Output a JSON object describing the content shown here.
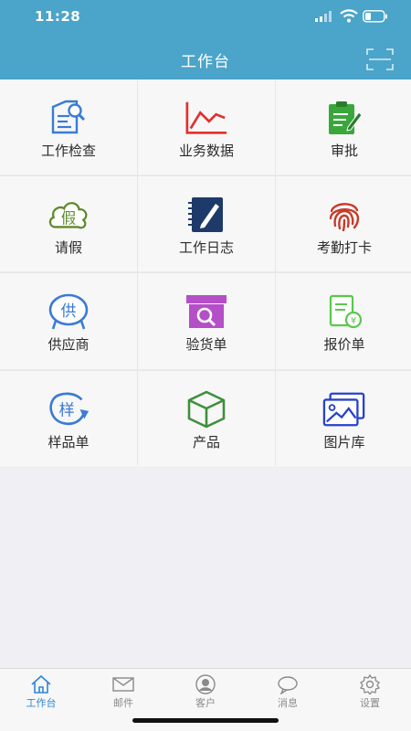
{
  "status_bar": {
    "time": "11:28"
  },
  "header": {
    "title": "工作台"
  },
  "grid": [
    {
      "label": "工作检查",
      "icon": "document-search-icon"
    },
    {
      "label": "业务数据",
      "icon": "line-chart-icon"
    },
    {
      "label": "审批",
      "icon": "clipboard-edit-icon"
    },
    {
      "label": "请假",
      "icon": "cloud-leave-icon",
      "glyph": "假"
    },
    {
      "label": "工作日志",
      "icon": "notebook-pen-icon"
    },
    {
      "label": "考勤打卡",
      "icon": "fingerprint-icon"
    },
    {
      "label": "供应商",
      "icon": "supplier-icon",
      "glyph": "供"
    },
    {
      "label": "验货单",
      "icon": "inspection-box-icon"
    },
    {
      "label": "报价单",
      "icon": "quote-document-icon",
      "glyph": "¥"
    },
    {
      "label": "样品单",
      "icon": "sample-refresh-icon",
      "glyph": "样"
    },
    {
      "label": "产品",
      "icon": "cube-icon"
    },
    {
      "label": "图片库",
      "icon": "image-gallery-icon"
    }
  ],
  "tabs": [
    {
      "label": "工作台",
      "icon": "home-icon",
      "active": true
    },
    {
      "label": "邮件",
      "icon": "mail-icon"
    },
    {
      "label": "客户",
      "icon": "user-icon"
    },
    {
      "label": "消息",
      "icon": "chat-bubble-icon"
    },
    {
      "label": "设置",
      "icon": "gear-icon"
    }
  ],
  "colors": {
    "header_bg": "#4ba4c9",
    "active_tab": "#2f86d6",
    "chart_red": "#e0312f",
    "approve_green": "#3aa73c",
    "navy": "#1d3a6a"
  }
}
